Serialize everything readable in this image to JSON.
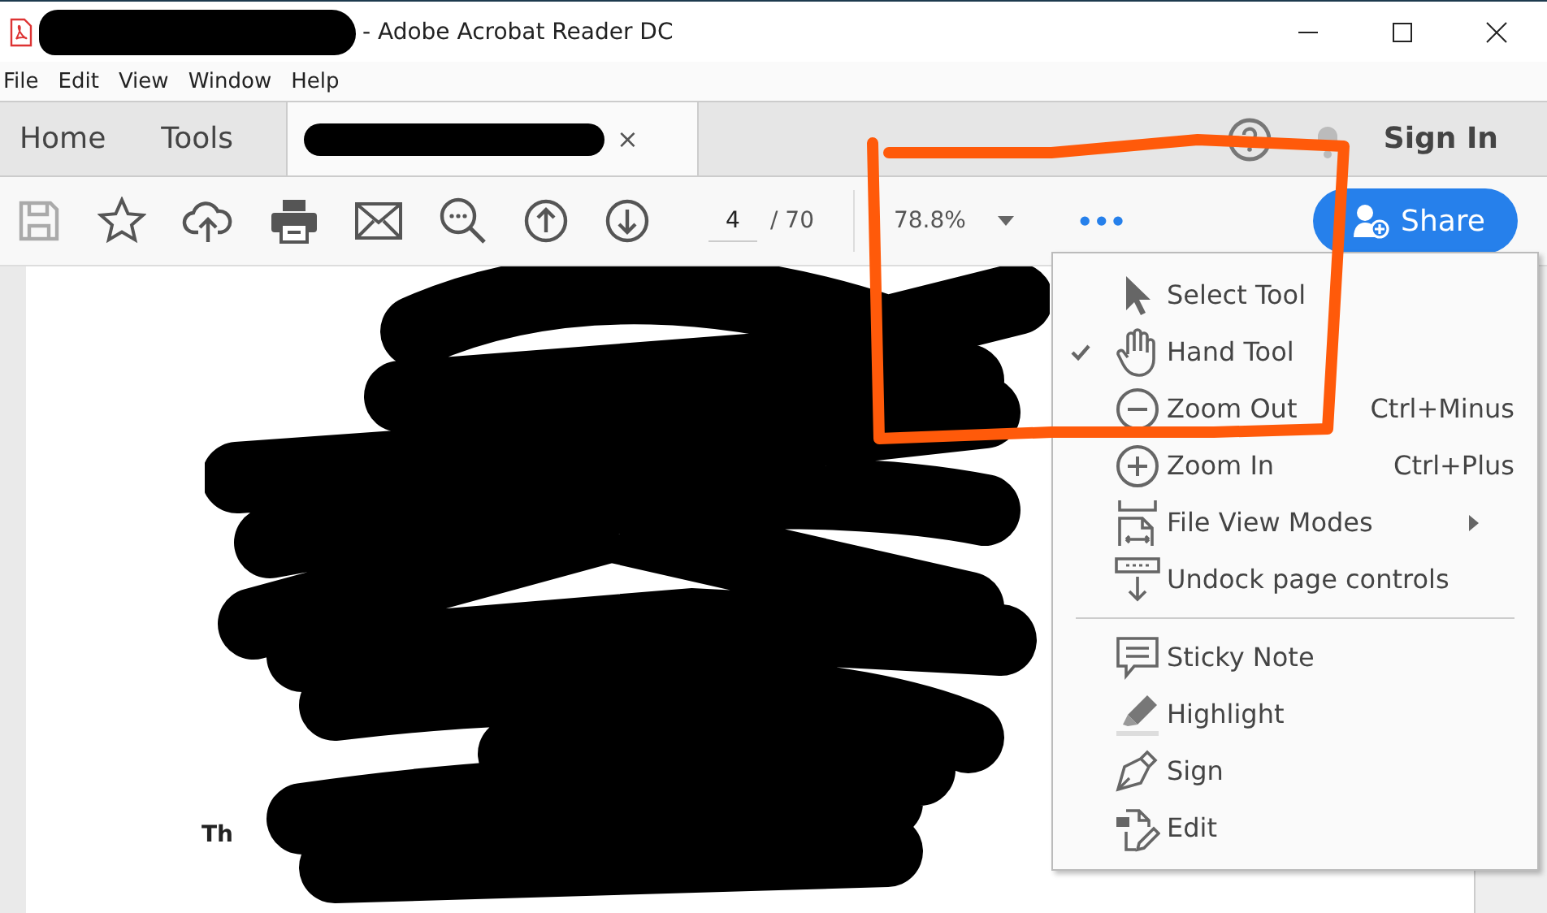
{
  "window": {
    "title": "- Adobe Acrobat Reader DC"
  },
  "menu_bar": [
    "File",
    "Edit",
    "View",
    "Window",
    "Help"
  ],
  "tabs": [
    {
      "label": "Home",
      "selected": false
    },
    {
      "label": "Tools",
      "selected": false
    },
    {
      "selected": true,
      "close": "×"
    }
  ],
  "sign_in": "Sign In",
  "toolbar": {
    "save_disabled": true,
    "page": "4",
    "page_total": "/ 70",
    "zoom": "78.8%",
    "more": "•••",
    "share": "Share"
  },
  "document": {
    "visible_text": "Th"
  },
  "menu": [
    {
      "kind": "item",
      "label": "Select Tool",
      "checked": false
    },
    {
      "kind": "item",
      "label": "Hand Tool",
      "checked": true
    },
    {
      "kind": "item",
      "label": "Zoom Out",
      "shortcut": "Ctrl+Minus",
      "checked": false
    },
    {
      "kind": "item",
      "label": "Zoom In",
      "shortcut": "Ctrl+Plus",
      "checked": false
    },
    {
      "kind": "item",
      "label": "File View Modes",
      "submenu": true,
      "checked": false
    },
    {
      "kind": "item",
      "label": "Undock page controls",
      "checked": false
    },
    {
      "kind": "separator"
    },
    {
      "kind": "item",
      "label": "Sticky Note",
      "checked": false
    },
    {
      "kind": "item",
      "label": "Highlight",
      "checked": false
    },
    {
      "kind": "item",
      "label": "Sign",
      "checked": false
    },
    {
      "kind": "item",
      "label": "Edit",
      "checked": false
    }
  ]
}
